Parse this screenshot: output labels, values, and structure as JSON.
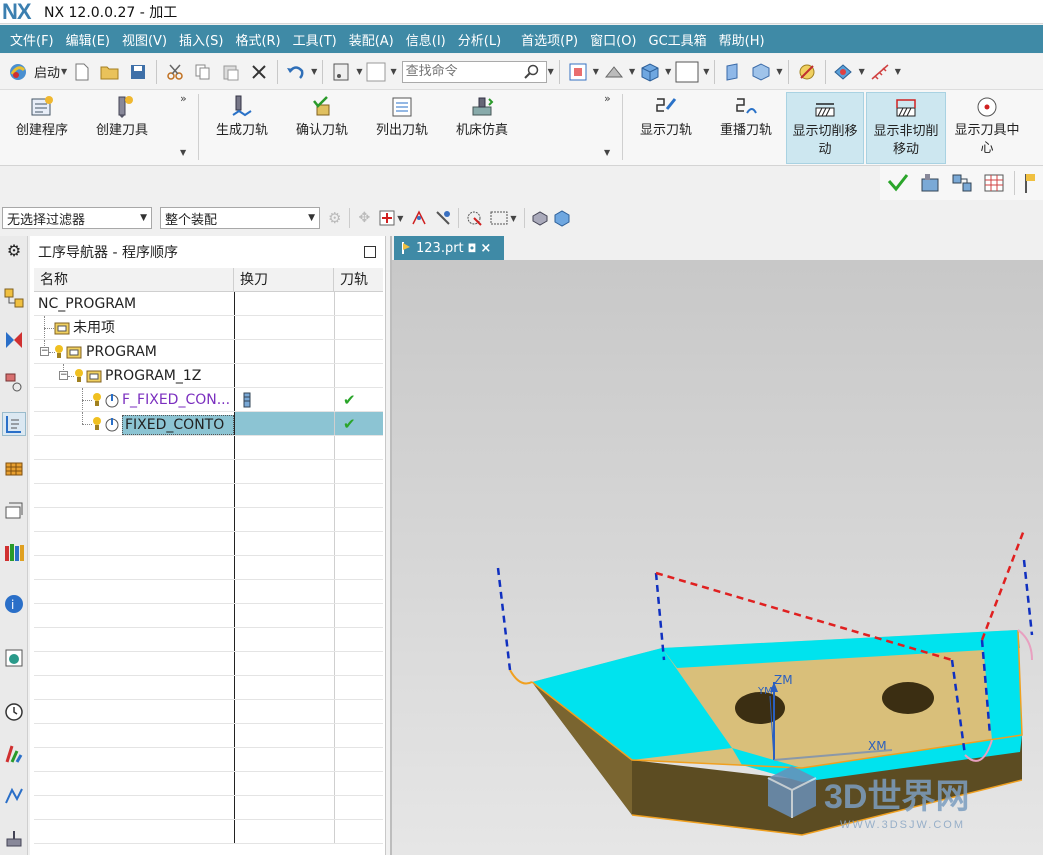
{
  "app": {
    "logo": "NX",
    "title": "NX 12.0.0.27 - 加工"
  },
  "menu": [
    "文件(F)",
    "编辑(E)",
    "视图(V)",
    "插入(S)",
    "格式(R)",
    "工具(T)",
    "装配(A)",
    "信息(I)",
    "分析(L)",
    "首选项(P)",
    "窗口(O)",
    "GC工具箱",
    "帮助(H)"
  ],
  "quickbar": {
    "start_label": "启动",
    "search_placeholder": "查找命令"
  },
  "ribbon": {
    "create_program": "创建程序",
    "create_tool": "创建刀具",
    "generate_path": "生成刀轨",
    "verify_path": "确认刀轨",
    "list_path": "列出刀轨",
    "machine_sim": "机床仿真",
    "show_path": "显示刀轨",
    "replay_path": "重播刀轨",
    "show_cut_move_1": "显示切削移",
    "show_cut_move_2": "动",
    "show_noncut_move_1": "显示非切削",
    "show_noncut_move_2": "移动",
    "show_tool_center_1": "显示刀具中",
    "show_tool_center_2": "心"
  },
  "filters": {
    "selection_filter": "无选择过滤器",
    "assembly_scope": "整个装配"
  },
  "navigator": {
    "title": "工序导航器 - 程序顺序",
    "columns": {
      "name": "名称",
      "tool_change": "换刀",
      "path": "刀轨"
    },
    "rows": [
      {
        "name": "NC_PROGRAM"
      },
      {
        "name": "未用项"
      },
      {
        "name": "PROGRAM"
      },
      {
        "name": "PROGRAM_1Z"
      },
      {
        "name": "F_FIXED_CON...",
        "path_status": "✔"
      },
      {
        "name": "FIXED_CONTO",
        "path_status": "✔"
      }
    ]
  },
  "viewport": {
    "tab_label": "123.prt",
    "axis_zm": "ZM",
    "axis_xm": "XM",
    "axis_ym": "YM",
    "watermark_title": "3D世界网",
    "watermark_url": "WWW.3DSJW.COM"
  },
  "colors": {
    "menubar": "#3f8aa6",
    "selected_row": "#8cc4d3",
    "part_top": "#00e5f0",
    "part_face": "#dcc27a",
    "part_side": "#6e5c2a",
    "rapid_move": "#e02020",
    "approach_move": "#1030c0"
  }
}
